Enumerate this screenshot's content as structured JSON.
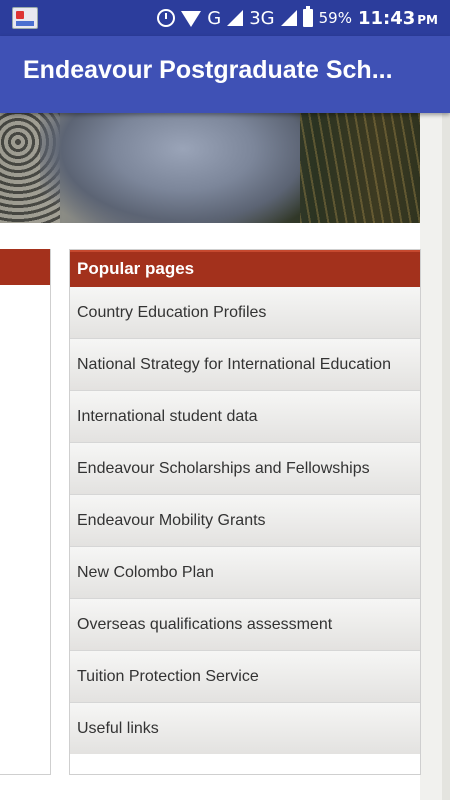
{
  "status_bar": {
    "network_label": "G",
    "network_label_2": "3G",
    "battery_percent": "59%",
    "time": "11:43",
    "ampm": "PM"
  },
  "app_bar": {
    "title": "Endeavour Postgraduate Sch..."
  },
  "popular_pages": {
    "header": "Popular pages",
    "items": [
      "Country Education Profiles",
      "National Strategy for International Education",
      "International student data",
      "Endeavour Scholarships and Fellowships",
      "Endeavour Mobility Grants",
      "New Colombo Plan",
      "Overseas qualifications assessment",
      "Tuition Protection Service",
      "Useful links"
    ]
  },
  "colors": {
    "status_bar": "#2c3d9c",
    "app_bar": "#3f51b5",
    "section_header": "#a3311c"
  }
}
